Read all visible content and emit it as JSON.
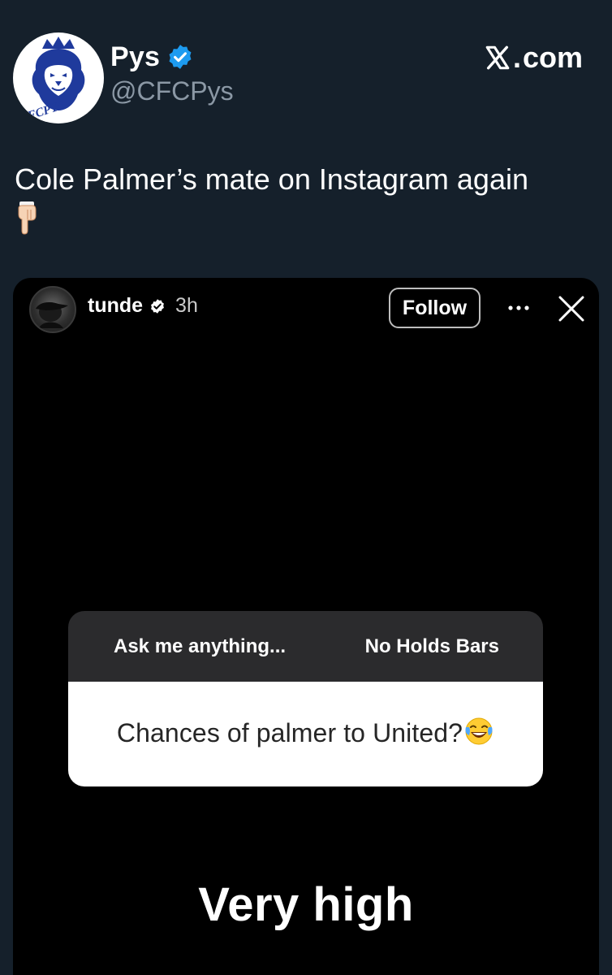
{
  "tweet": {
    "author": {
      "display_name": "Pys",
      "handle": "@CFCPys",
      "avatar_icon": "cfcpys-lion-logo",
      "avatar_text": "CFCPYS",
      "verified": true,
      "verified_color": "#1d9bf0"
    },
    "source": "com",
    "source_icon": "x-logo-icon",
    "text": "Cole Palmer’s mate on Instagram again",
    "text_emoji": "backhand-index-pointing-down-icon"
  },
  "story": {
    "username": "tunde",
    "verified": true,
    "time": "3h",
    "follow_label": "Follow",
    "more_icon": "more-icon",
    "close_icon": "close-icon",
    "sticker": {
      "prompt": "Ask me anything...",
      "tag": "No Holds Bars",
      "question": "Chances of palmer to United?",
      "question_emoji": "face-with-tears-of-joy-icon"
    },
    "answer": "Very high"
  },
  "colors": {
    "background": "#15202b",
    "secondary_text": "#8b98a5",
    "story_background": "#000000",
    "sticker_header": "#2b2b2d",
    "brand_blue": "#1f3a9c"
  }
}
